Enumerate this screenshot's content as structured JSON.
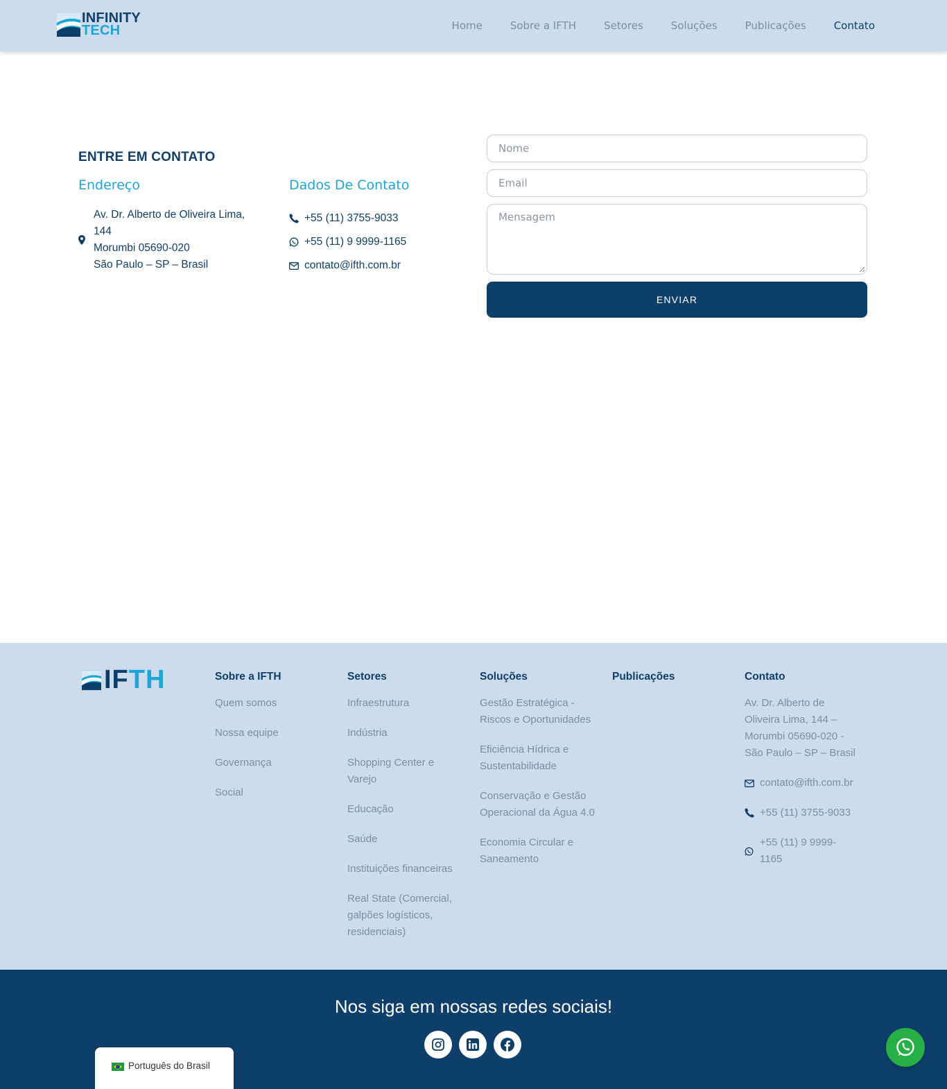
{
  "header": {
    "logo_line1": "INFINITY",
    "logo_line2": "TECH",
    "nav": [
      {
        "label": "Home"
      },
      {
        "label": "Sobre a IFTH"
      },
      {
        "label": "Setores"
      },
      {
        "label": "Soluções"
      },
      {
        "label": "Publicações"
      },
      {
        "label": "Contato",
        "active": true
      }
    ]
  },
  "contact": {
    "title": "ENTRE EM CONTATO",
    "address_heading": "Endereço",
    "address_lines": [
      "Av. Dr. Alberto de Oliveira Lima,",
      "144",
      "Morumbi 05690-020",
      "São Paulo – SP – Brasil"
    ],
    "data_heading": "Dados De Contato",
    "phone": "+55 (11) 3755-9033",
    "whatsapp": "+55 (11) 9 9999-1165",
    "email": "contato@ifth.com.br"
  },
  "form": {
    "name_placeholder": "Nome",
    "email_placeholder": "Email",
    "message_placeholder": "Mensagem",
    "submit_label": "ENVIAR"
  },
  "footer": {
    "logo_a": "IF",
    "logo_b": "TH",
    "sobre": {
      "heading": "Sobre a IFTH",
      "links": [
        "Quem somos",
        "Nossa equipe",
        "Governança",
        "Social"
      ]
    },
    "setores": {
      "heading": "Setores",
      "links": [
        "Infraestrutura",
        "Indústria",
        "Shopping Center e Varejo",
        "Educação",
        "Saúde",
        "Instituições financeiras",
        "Real State (Comercial, galpões logísticos, residenciais)"
      ]
    },
    "solucoes": {
      "heading": "Soluções",
      "links": [
        "Gestão Estratégica - Riscos e Oportunidades",
        "Eficiência Hídrica e Sustentabilidade",
        "Conservação e Gestão Operacional da Água 4.0",
        "Economia Circular e Saneamento"
      ]
    },
    "publicacoes": {
      "heading": "Publicações"
    },
    "contato": {
      "heading": "Contato",
      "address": "Av. Dr. Alberto de Oliveira Lima, 144 – Morumbi 05690-020 - São Paulo – SP – Brasil",
      "email": "contato@ifth.com.br",
      "phone": "+55 (11) 3755-9033",
      "whatsapp": "+55 (11) 9 9999-1165"
    }
  },
  "bottom": {
    "social_title": "Nos siga em nossas redes sociais!",
    "socials": [
      "instagram-icon",
      "linkedin-icon",
      "facebook-icon"
    ]
  },
  "language": {
    "label": "Português do Brasil"
  },
  "colors": {
    "primary": "#0e3f6b",
    "accent": "#1ba6d9",
    "light_bg": "#cddcec",
    "whatsapp": "#27b045"
  }
}
